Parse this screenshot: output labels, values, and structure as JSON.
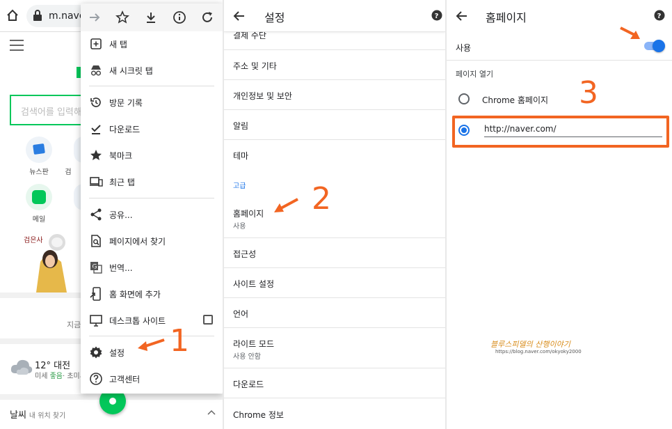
{
  "browser_bg": {
    "url": "m.naver",
    "search_placeholder": "검색어를 입력해",
    "quick_links": [
      {
        "icon": "news-icon",
        "label": "뉴스판"
      },
      {
        "icon": "mail-icon",
        "label": "메일"
      }
    ],
    "partial_label_1": "검",
    "now_text": "지금",
    "weather": {
      "temp": "12° 대전",
      "dust_prefix": "미세",
      "dust_status": "좋음",
      "dust_suffix": "· 초미시",
      "section_title": "날씨",
      "location": "내 위치 찾기"
    }
  },
  "menu": {
    "top_icons": [
      "forward-icon",
      "bookmark-star-icon",
      "download-icon",
      "info-icon",
      "reload-icon"
    ],
    "items": [
      {
        "icon": "new-tab-icon",
        "label": "새 탭"
      },
      {
        "icon": "incognito-icon",
        "label": "새 시크릿 탭"
      },
      {
        "icon": "history-icon",
        "label": "방문 기록"
      },
      {
        "icon": "downloads-icon",
        "label": "다운로드"
      },
      {
        "icon": "bookmarks-icon",
        "label": "북마크"
      },
      {
        "icon": "recent-tabs-icon",
        "label": "최근 탭"
      },
      {
        "icon": "share-icon",
        "label": "공유..."
      },
      {
        "icon": "find-in-page-icon",
        "label": "페이지에서 찾기"
      },
      {
        "icon": "translate-icon",
        "label": "번역..."
      },
      {
        "icon": "add-to-home-icon",
        "label": "홈 화면에 추가"
      },
      {
        "icon": "desktop-site-icon",
        "label": "데스크톱 사이트",
        "checkbox": false
      },
      {
        "icon": "settings-icon",
        "label": "설정"
      },
      {
        "icon": "help-icon",
        "label": "고객센터"
      }
    ]
  },
  "settings": {
    "title": "설정",
    "rows": [
      {
        "title": "결제 수단"
      },
      {
        "title": "주소 및 기타"
      },
      {
        "title": "개인정보 및 보안"
      },
      {
        "title": "알림"
      },
      {
        "title": "테마"
      },
      {
        "title": "홈페이지",
        "subtitle": "사용"
      },
      {
        "title": "접근성"
      },
      {
        "title": "사이트 설정"
      },
      {
        "title": "언어"
      },
      {
        "title": "라이트 모드",
        "subtitle": "사용 안함"
      },
      {
        "title": "다운로드"
      },
      {
        "title": "Chrome 정보"
      }
    ],
    "section_advanced": "고급"
  },
  "homepage": {
    "title": "홈페이지",
    "toggle_label": "사용",
    "toggle_on": true,
    "open_page_label": "페이지 열기",
    "option_chrome": "Chrome 홈페이지",
    "option_custom_url": "http://naver.com/",
    "selected": "custom"
  },
  "annotations": {
    "step1": "1",
    "step2": "2",
    "step3": "3",
    "accent_color": "#f26522"
  },
  "watermark": {
    "line1": "블루스피델의 산행이야기",
    "line2": "https://blog.naver.com/okyoky2000"
  }
}
